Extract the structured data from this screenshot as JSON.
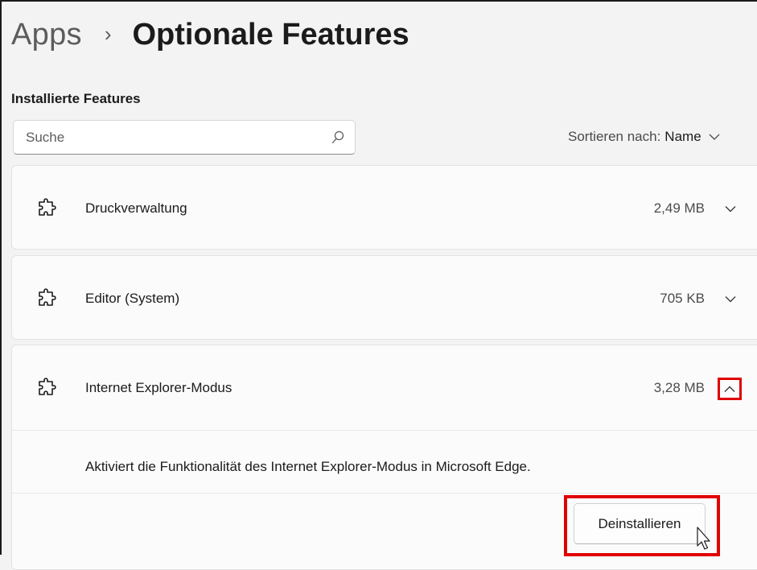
{
  "breadcrumb": {
    "parent": "Apps",
    "separator": "›",
    "current": "Optionale Features"
  },
  "section_title": "Installierte Features",
  "search": {
    "placeholder": "Suche",
    "value": ""
  },
  "sort": {
    "label": "Sortieren nach:",
    "value": "Name"
  },
  "features": [
    {
      "name": "Druckverwaltung",
      "size": "2,49 MB",
      "expanded": false,
      "icon": "puzzle-icon"
    },
    {
      "name": "Editor (System)",
      "size": "705 KB",
      "expanded": false,
      "icon": "puzzle-icon"
    },
    {
      "name": "Internet Explorer-Modus",
      "size": "3,28 MB",
      "expanded": true,
      "icon": "puzzle-icon",
      "description": "Aktiviert die Funktionalität des Internet Explorer-Modus in Microsoft Edge.",
      "action_label": "Deinstallieren"
    }
  ],
  "colors": {
    "highlight": "#e00000",
    "background": "#f3f3f3",
    "card": "#fbfbfb"
  }
}
